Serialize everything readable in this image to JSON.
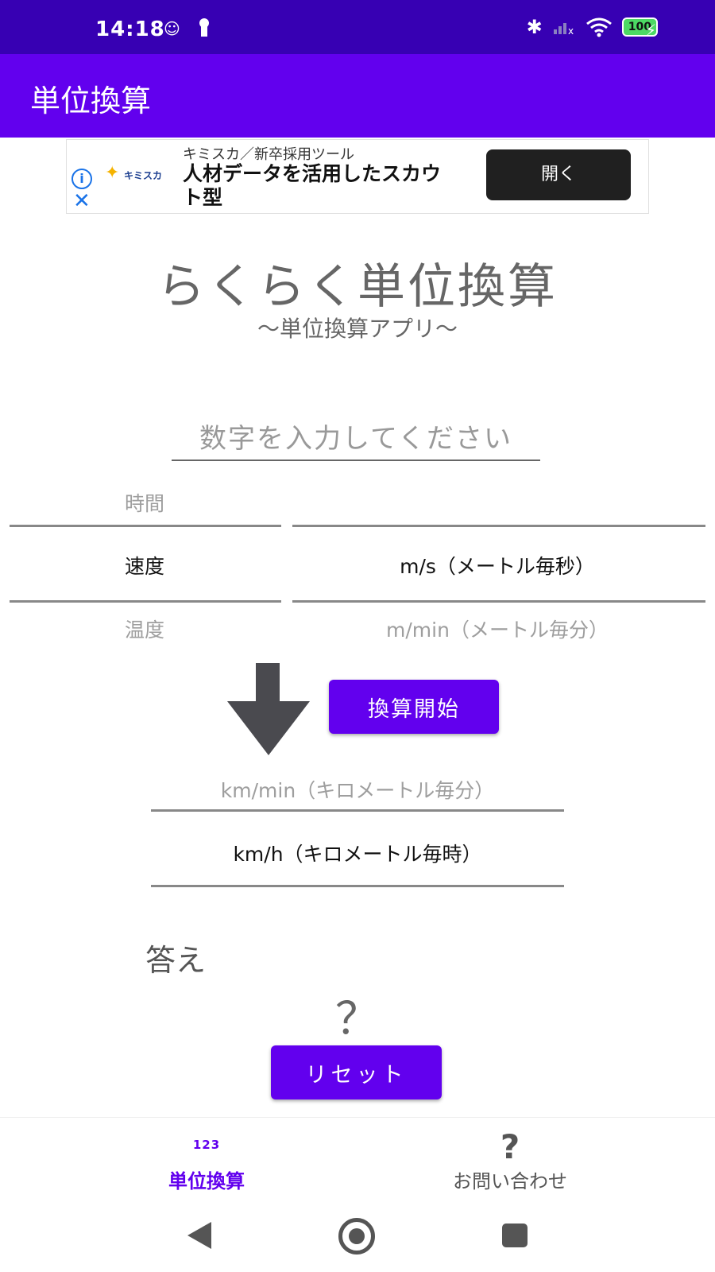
{
  "status_bar": {
    "time": "14:18",
    "battery": "100"
  },
  "app_bar": {
    "title": "単位換算"
  },
  "ad": {
    "subtitle": "キミスカ／新卒採用ツール",
    "headline": "人材データを活用したスカウト型",
    "logo_text": "キミスカ",
    "open_label": "開く"
  },
  "header": {
    "title": "らくらく単位換算",
    "subtitle": "〜単位換算アプリ〜"
  },
  "input": {
    "placeholder": "数字を入力してください"
  },
  "category_picker": {
    "prev": "時間",
    "current": "速度",
    "next": "温度"
  },
  "from_unit_picker": {
    "current": "m/s（メートル毎秒）",
    "next": "m/min（メートル毎分）"
  },
  "convert": {
    "label": "換算開始"
  },
  "to_unit_picker": {
    "prev": "km/min（キロメートル毎分）",
    "current": "km/h（キロメートル毎時）"
  },
  "answer": {
    "label": "答え",
    "value": "？"
  },
  "reset": {
    "label": "リセット"
  },
  "bottom_nav": {
    "convert_icon_text": "123",
    "convert_label": "単位換算",
    "contact_icon_text": "?",
    "contact_label": "お問い合わせ"
  },
  "colors": {
    "accent": "#6200ee",
    "status_bar": "#3700b3"
  }
}
